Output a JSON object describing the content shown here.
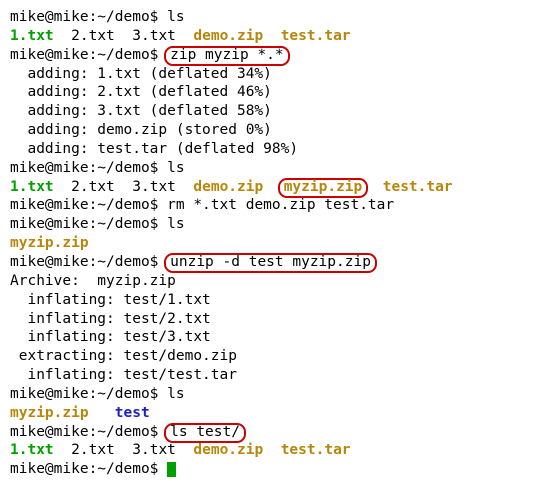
{
  "prompt": "mike@mike:~/demo$ ",
  "cmd": {
    "ls": "ls",
    "zip": "zip myzip *.*",
    "rm": "rm *.txt demo.zip test.tar",
    "unzip": "unzip -d test myzip.zip",
    "lstest": "ls test/"
  },
  "files": {
    "f1": "1.txt",
    "f2": "2.txt",
    "f3": "3.txt",
    "demo": "demo.zip",
    "test_tar": "test.tar",
    "myzip": "myzip.zip",
    "test_dir": "test"
  },
  "zip_out": {
    "l1": "  adding: 1.txt (deflated 34%)",
    "l2": "  adding: 2.txt (deflated 46%)",
    "l3": "  adding: 3.txt (deflated 58%)",
    "l4": "  adding: demo.zip (stored 0%)",
    "l5": "  adding: test.tar (deflated 98%)"
  },
  "unzip_out": {
    "h": "Archive:  myzip.zip",
    "l1": "  inflating: test/1.txt",
    "l2": "  inflating: test/2.txt",
    "l3": "  inflating: test/3.txt",
    "l4": " extracting: test/demo.zip",
    "l5": "  inflating: test/test.tar"
  },
  "sp": {
    "two": "  ",
    "three": "   ",
    "four": "    "
  }
}
